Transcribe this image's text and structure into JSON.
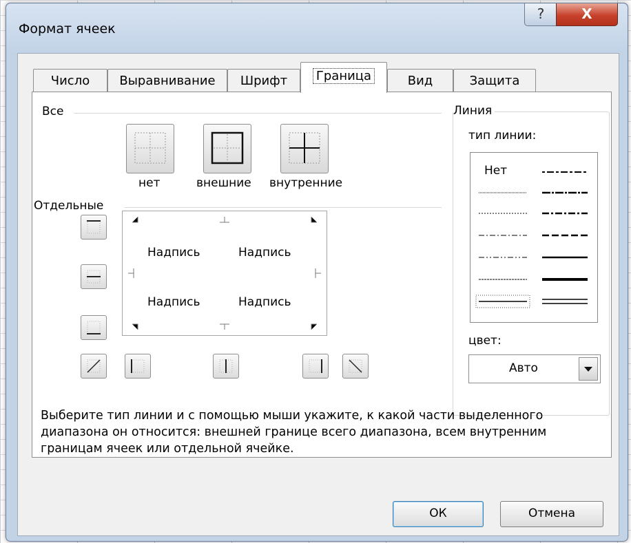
{
  "dialog": {
    "title": "Формат ячеек",
    "help_glyph": "?",
    "close_glyph": "X"
  },
  "tabs": [
    {
      "label": "Число"
    },
    {
      "label": "Выравнивание"
    },
    {
      "label": "Шрифт"
    },
    {
      "label": "Граница",
      "active": true
    },
    {
      "label": "Вид"
    },
    {
      "label": "Защита"
    }
  ],
  "presets": {
    "group_label": "Все",
    "none_label": "нет",
    "outline_label": "внешние",
    "inside_label": "внутренние"
  },
  "border": {
    "group_label": "Отдельные",
    "preview_texts": [
      "Надпись",
      "Надпись",
      "Надпись",
      "Надпись"
    ]
  },
  "line": {
    "group_label": "Линия",
    "style_label": "тип линии:",
    "none_label": "Нет",
    "color_label": "цвет:",
    "color_value": "Авто"
  },
  "hint": "Выберите тип линии и с помощью мыши укажите, к какой части выделенного диапазона он относится: внешней границе всего диапазона, всем внутренним границам ячеек или отдельной ячейке.",
  "buttons": {
    "ok": "ОК",
    "cancel": "Отмена"
  },
  "colors": {
    "accent": "#3c7fb1",
    "close": "#c7412b"
  }
}
